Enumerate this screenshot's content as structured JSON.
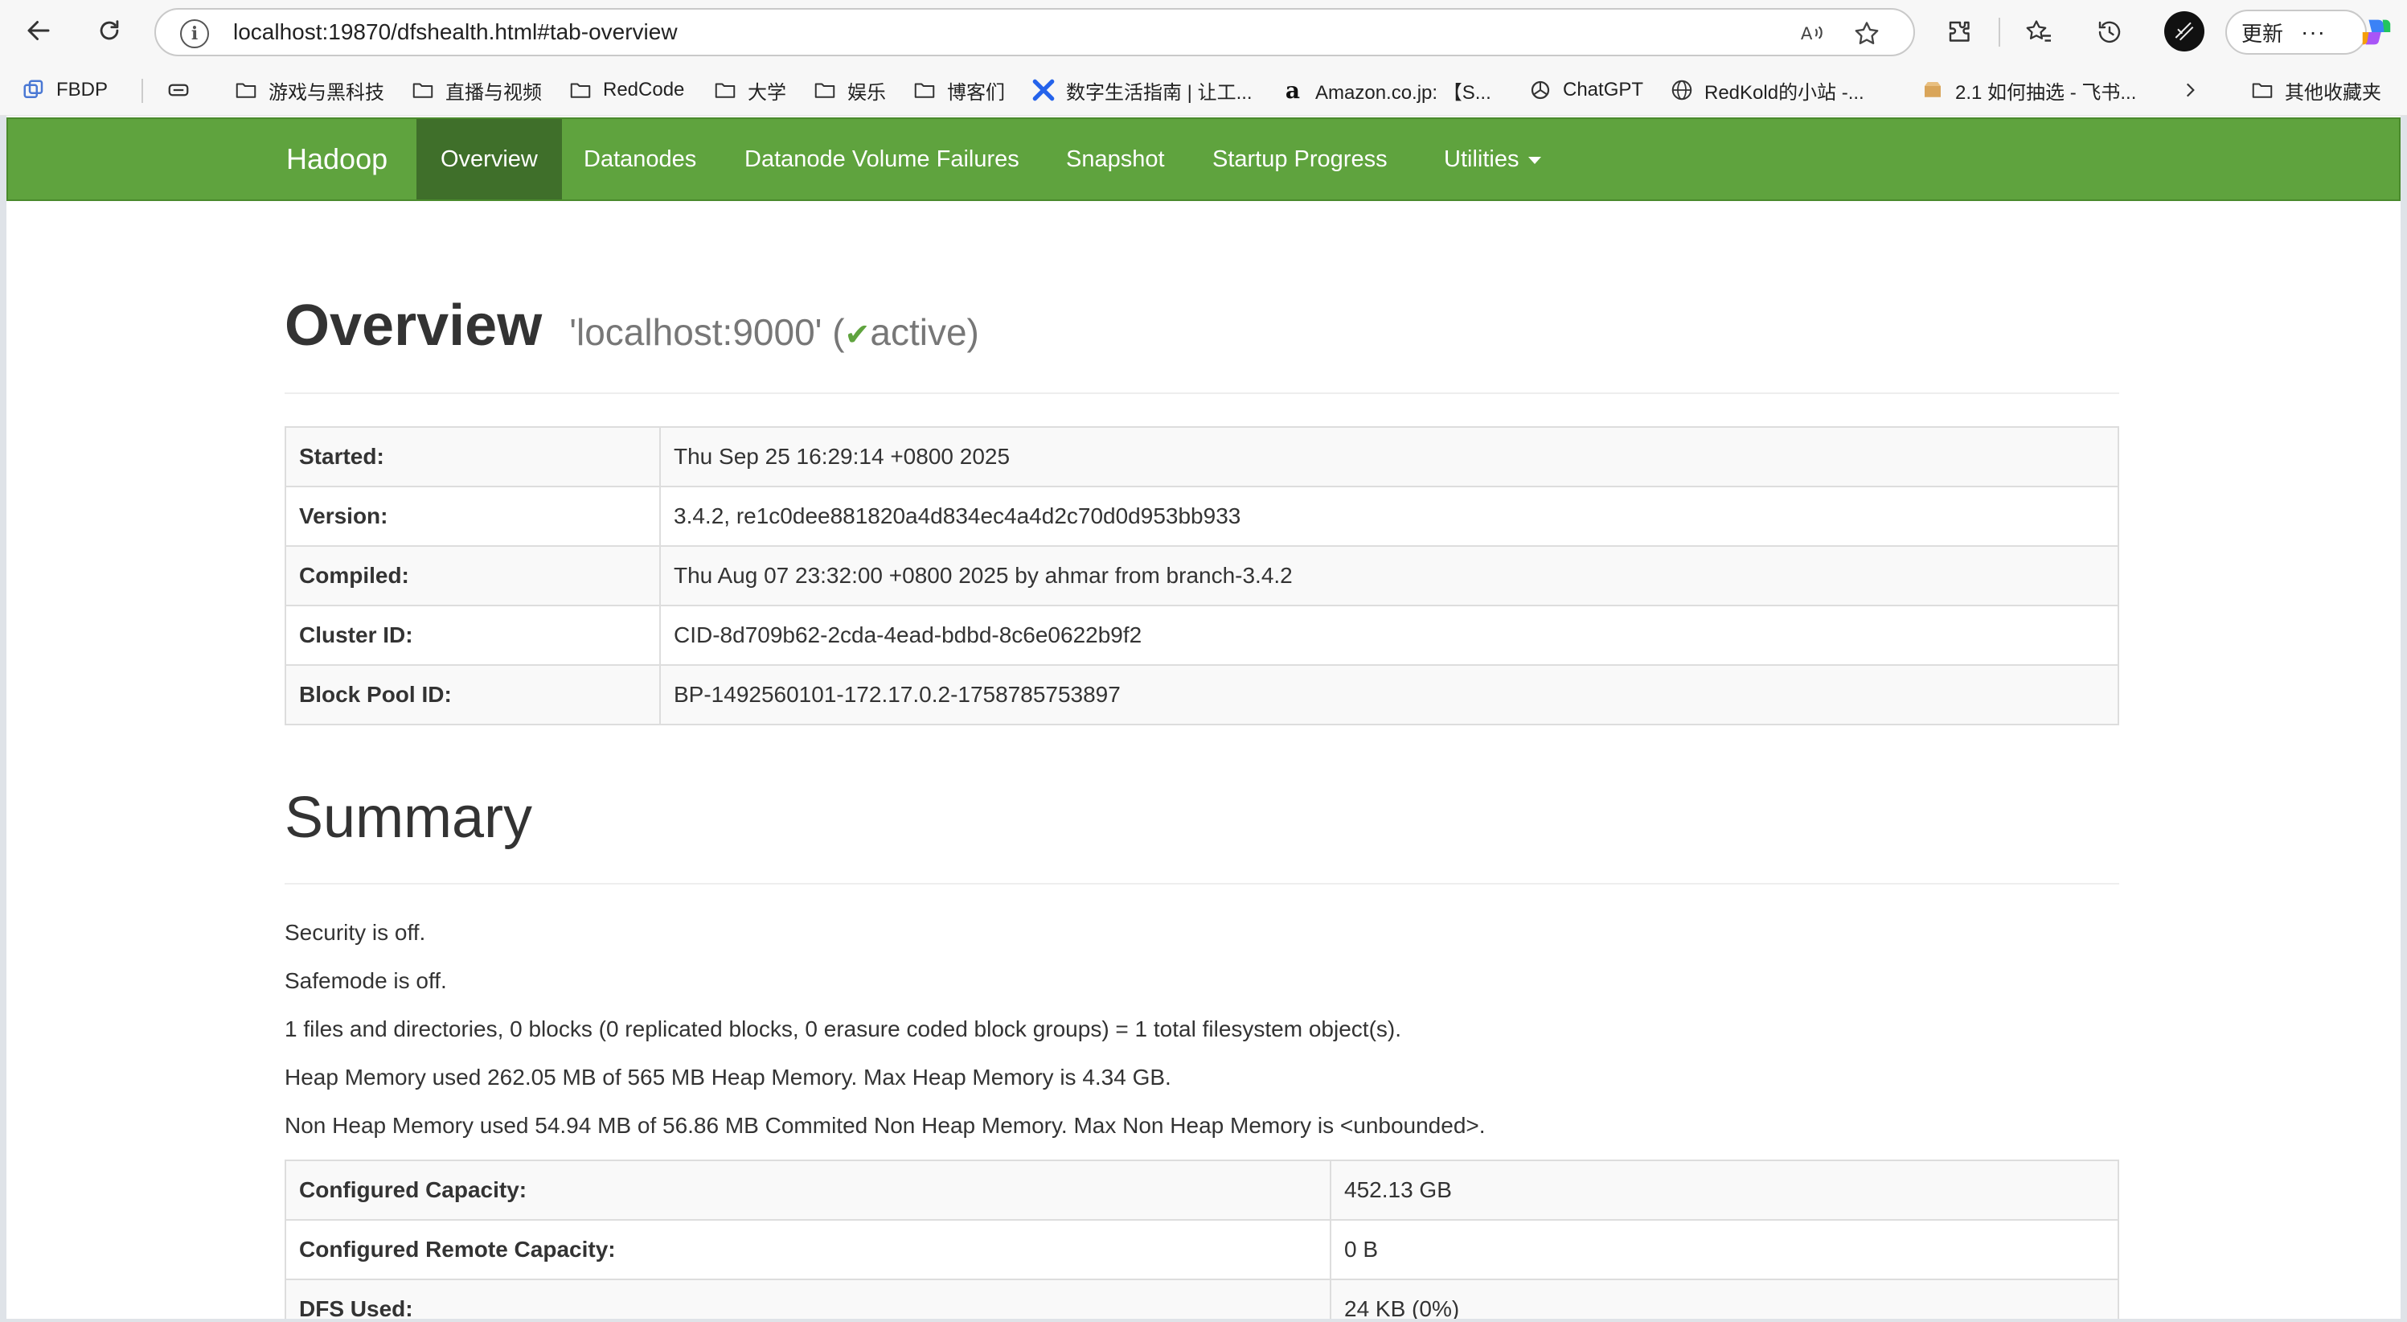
{
  "browser": {
    "url": "localhost:19870/dfshealth.html#tab-overview",
    "update_label": "更新",
    "more_label": "···"
  },
  "bookmarks": [
    {
      "label": "FBDP",
      "icon": "stack-icon"
    },
    {
      "label": "",
      "icon": "tab-icon"
    },
    {
      "label": "游戏与黑科技",
      "icon": "folder-icon"
    },
    {
      "label": "直播与视频",
      "icon": "folder-icon"
    },
    {
      "label": "RedCode",
      "icon": "folder-icon"
    },
    {
      "label": "大学",
      "icon": "folder-icon"
    },
    {
      "label": "娱乐",
      "icon": "folder-icon"
    },
    {
      "label": "博客们",
      "icon": "folder-icon"
    },
    {
      "label": "数字生活指南 | 让工...",
      "icon": "x-logo-icon"
    },
    {
      "label": "Amazon.co.jp: 【S...",
      "icon": "amazon-icon"
    },
    {
      "label": "ChatGPT",
      "icon": "chatgpt-icon"
    },
    {
      "label": "RedKold的小站 -...",
      "icon": "globe-icon"
    },
    {
      "label": "2.1 如何抽选 - 飞书...",
      "icon": "box-icon"
    },
    {
      "label": "其他收藏夹",
      "icon": "folder-icon"
    }
  ],
  "navbar": {
    "brand": "Hadoop",
    "items": [
      "Overview",
      "Datanodes",
      "Datanode Volume Failures",
      "Snapshot",
      "Startup Progress",
      "Utilities"
    ]
  },
  "overview": {
    "title": "Overview",
    "host": "'localhost:9000' (",
    "check": "✔",
    "state": "active)",
    "rows": [
      {
        "key": "Started:",
        "value": "Thu Sep 25 16:29:14 +0800 2025"
      },
      {
        "key": "Version:",
        "value": "3.4.2, re1c0dee881820a4d834ec4a4d2c70d0d953bb933"
      },
      {
        "key": "Compiled:",
        "value": "Thu Aug 07 23:32:00 +0800 2025 by ahmar from branch-3.4.2"
      },
      {
        "key": "Cluster ID:",
        "value": "CID-8d709b62-2cda-4ead-bdbd-8c6e0622b9f2"
      },
      {
        "key": "Block Pool ID:",
        "value": "BP-1492560101-172.17.0.2-1758785753897"
      }
    ]
  },
  "summary": {
    "title": "Summary",
    "lines": [
      "Security is off.",
      "Safemode is off.",
      "1 files and directories, 0 blocks (0 replicated blocks, 0 erasure coded block groups) = 1 total filesystem object(s).",
      "Heap Memory used 262.05 MB of 565 MB Heap Memory. Max Heap Memory is 4.34 GB.",
      "Non Heap Memory used 54.94 MB of 56.86 MB Commited Non Heap Memory. Max Non Heap Memory is <unbounded>."
    ],
    "rows": [
      {
        "key": "Configured Capacity:",
        "value": "452.13 GB"
      },
      {
        "key": "Configured Remote Capacity:",
        "value": "0 B"
      },
      {
        "key": "DFS Used:",
        "value": "24 KB (0%)"
      }
    ]
  }
}
